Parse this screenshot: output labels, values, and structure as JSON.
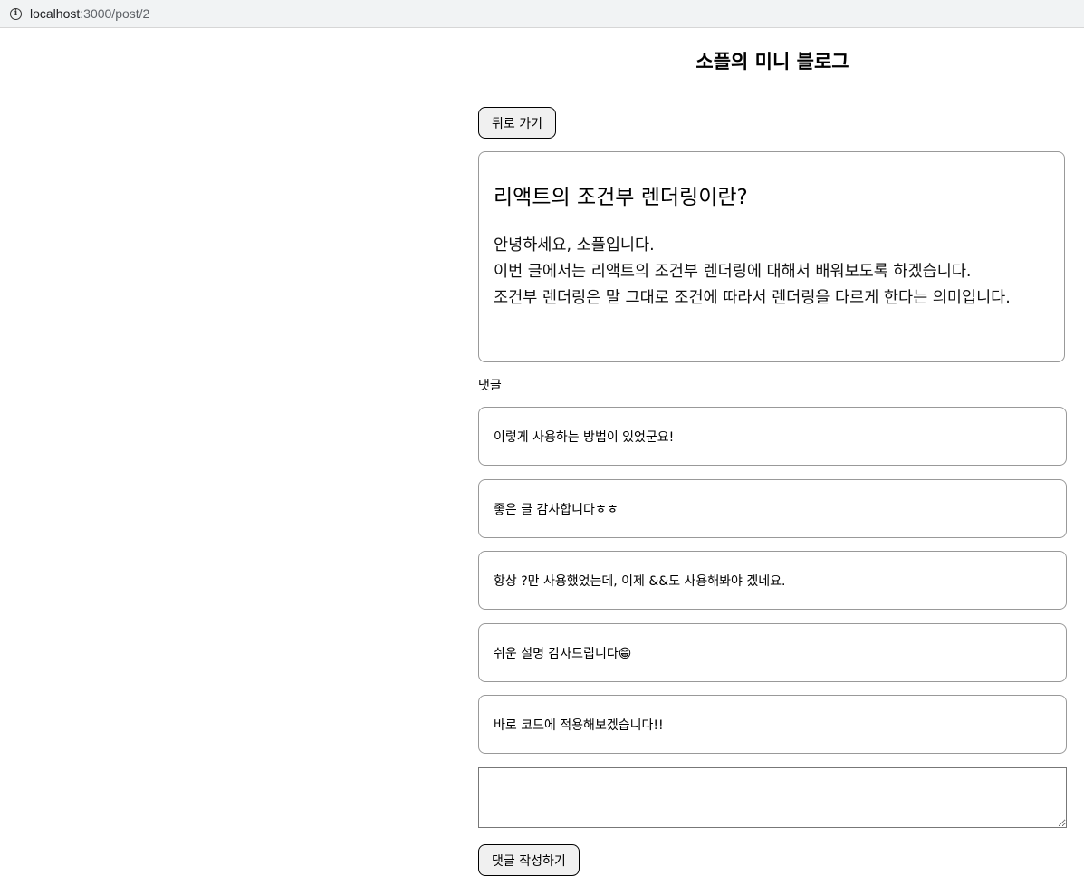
{
  "browser": {
    "url_host": "localhost",
    "url_path": ":3000/post/2"
  },
  "header": {
    "title": "소플의 미니 블로그"
  },
  "actions": {
    "back_label": "뒤로 가기",
    "submit_label": "댓글 작성하기"
  },
  "post": {
    "title": "리액트의 조건부 렌더링이란?",
    "content": "안녕하세요, 소플입니다.\n이번 글에서는 리액트의 조건부 렌더링에 대해서 배워보도록 하겠습니다.\n조건부 렌더링은 말 그대로 조건에 따라서 렌더링을 다르게 한다는 의미입니다."
  },
  "comments": {
    "label": "댓글",
    "items": [
      "이렇게 사용하는 방법이 있었군요!",
      "좋은 글 감사합니다ㅎㅎ",
      "항상 ?만 사용했었는데, 이제 &&도 사용해봐야 겠네요.",
      "쉬운 설명 감사드립니다😁",
      "바로 코드에 적용해보겠습니다!!"
    ],
    "input_value": ""
  }
}
